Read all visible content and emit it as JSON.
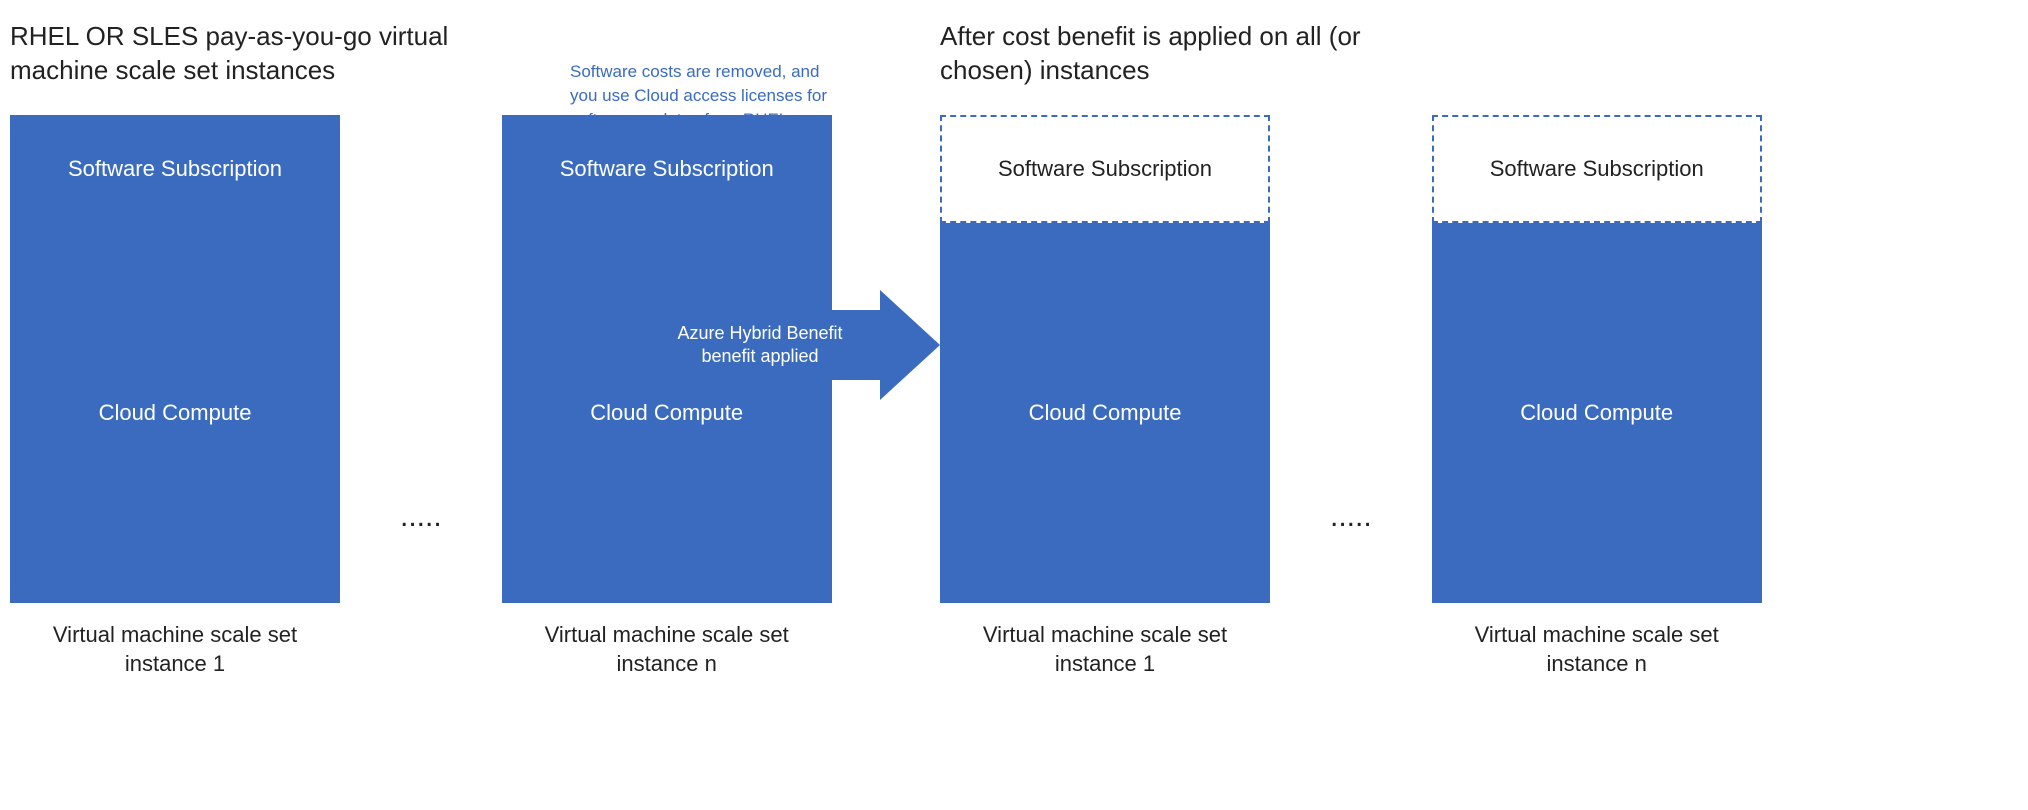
{
  "left_title": "RHEL OR SLES pay-as-you-go virtual machine scale set instances",
  "right_title": "After cost benefit is applied on all (or chosen) instances",
  "note_text": "Software costs are removed, and you use Cloud access licenses for software updates from RHEL or SUSE.",
  "arrow_label": "Azure Hybrid Benefit benefit applied",
  "software_subscription_label": "Software Subscription",
  "cloud_compute_label": "Cloud Compute",
  "vm_label_1": "Virtual machine scale set instance 1",
  "vm_label_n": "Virtual machine scale set instance n",
  "ellipsis": ".....",
  "colors": {
    "blue": "#3a6bbf",
    "text": "#222222",
    "note_blue": "#3a6bbf"
  }
}
